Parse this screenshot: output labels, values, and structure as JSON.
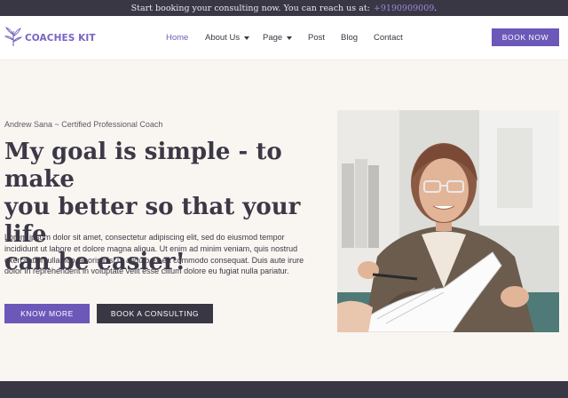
{
  "topbar": {
    "message": "Start booking your consulting now. You can reach us at:",
    "phone": "+9190909009",
    "suffix": "."
  },
  "logo": {
    "text": "COACHES KIT",
    "icon": "leaf-branch-icon"
  },
  "nav": {
    "items": [
      {
        "label": "Home",
        "active": true,
        "dropdown": false
      },
      {
        "label": "About Us",
        "active": false,
        "dropdown": true
      },
      {
        "label": "Page",
        "active": false,
        "dropdown": true
      },
      {
        "label": "Post",
        "active": false,
        "dropdown": false
      },
      {
        "label": "Blog",
        "active": false,
        "dropdown": false
      },
      {
        "label": "Contact",
        "active": false,
        "dropdown": false
      }
    ],
    "cta_label": "BOOK NOW"
  },
  "hero": {
    "eyebrow": "Andrew Sana ~ Certified Professional Coach",
    "headline_line1": "My goal is simple - to make",
    "headline_line2": "you better so that your life",
    "headline_line3": "can be easier!",
    "body": "Lorem ipsum dolor sit amet, consectetur adipiscing elit, sed do eiusmod tempor incididunt ut labore et dolore magna aliqua. Ut enim ad minim veniam, quis nostrud exercitation ullamco laboris nisi ut aliquip ex ea commodo consequat. Duis aute irure dolor in reprehenderit in voluptate velit esse cillum dolore eu fugiat nulla pariatur.",
    "primary_button": "KNOW MORE",
    "secondary_button": "BOOK A CONSULTING"
  },
  "colors": {
    "accent": "#6b58b9",
    "dark": "#3a3744",
    "background": "#f9f6f2"
  }
}
